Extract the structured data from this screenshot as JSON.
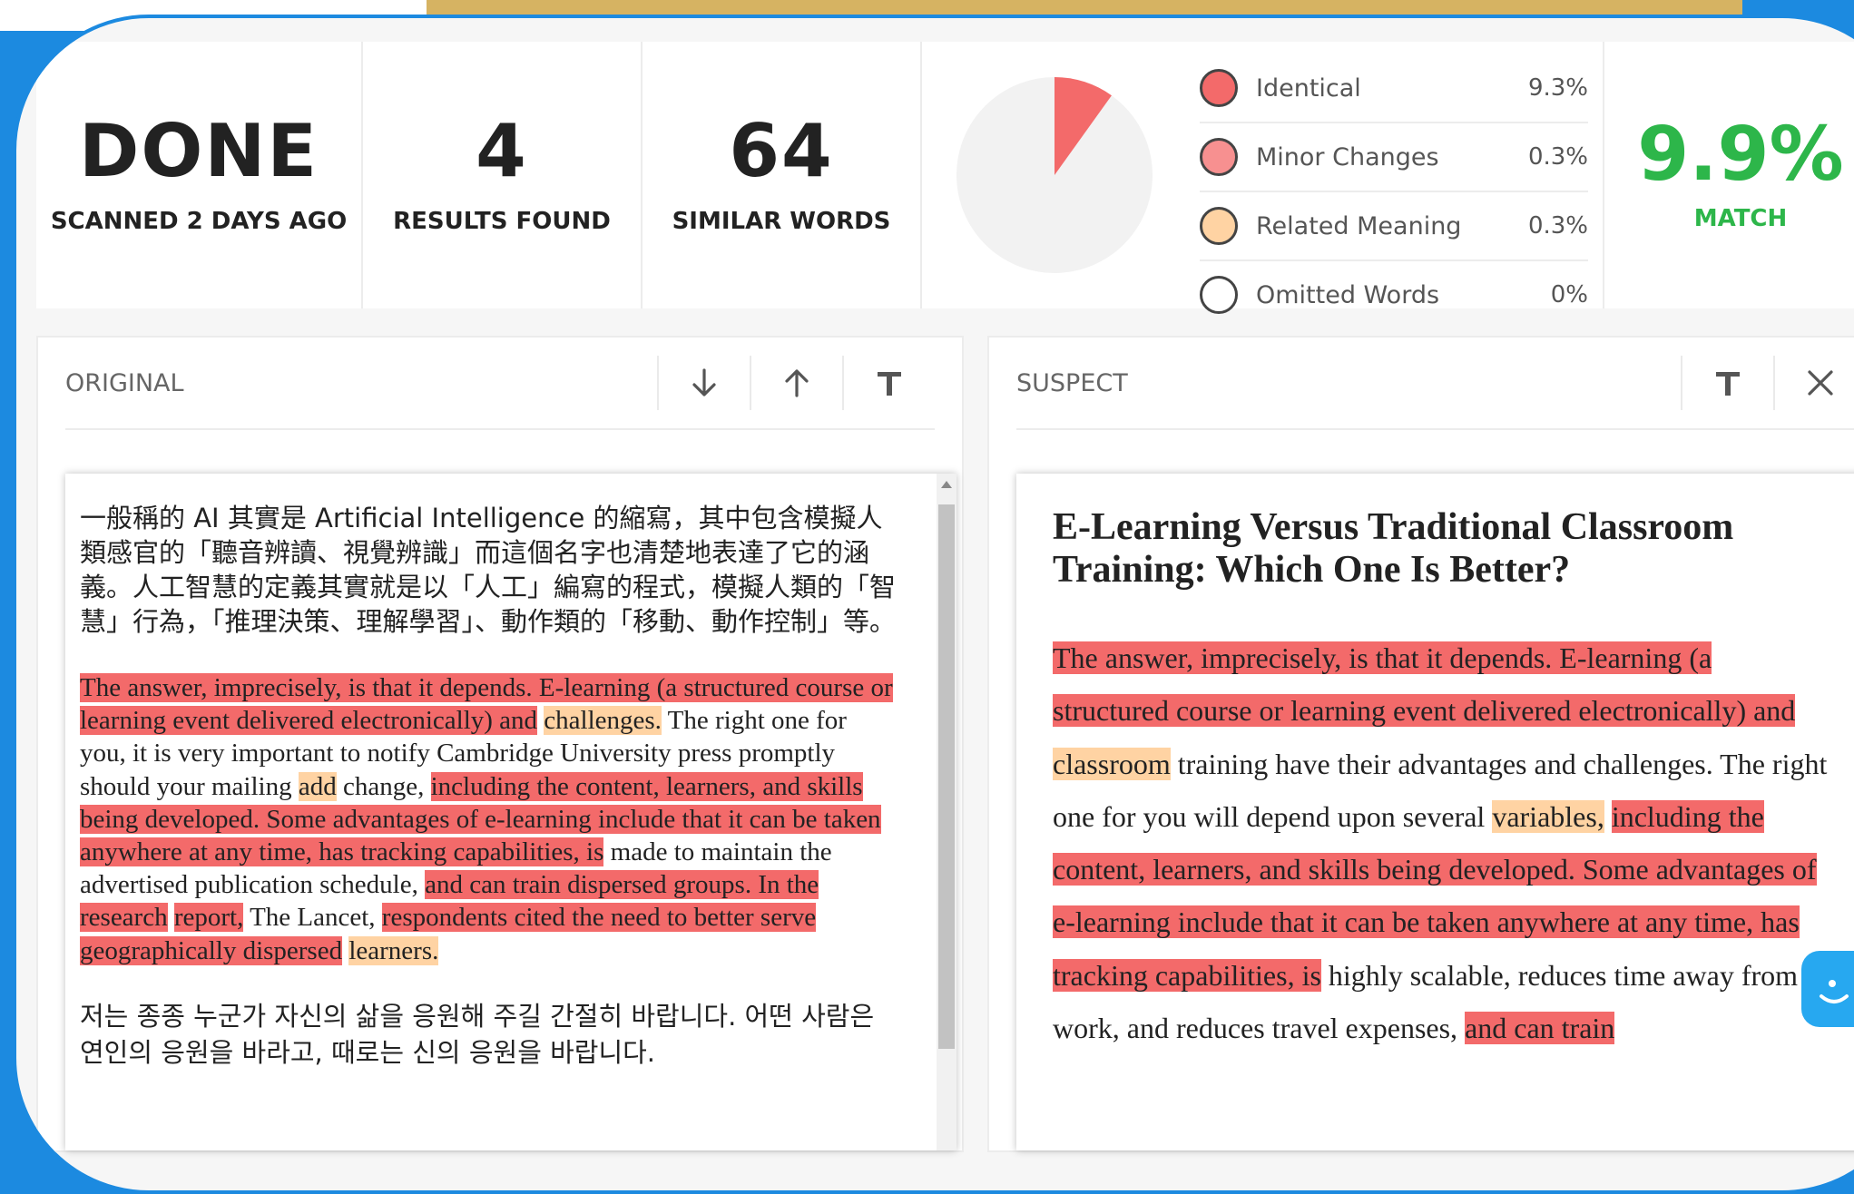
{
  "stats": {
    "status": {
      "value": "DONE",
      "label": "SCANNED 2 DAYS AGO"
    },
    "results": {
      "value": "4",
      "label": "RESULTS FOUND"
    },
    "similar": {
      "value": "64",
      "label": "SIMILAR WORDS"
    }
  },
  "legend": [
    {
      "label": "Identical",
      "value": "9.3%",
      "color": "#f36a6a"
    },
    {
      "label": "Minor Changes",
      "value": "0.3%",
      "color": "#f79090"
    },
    {
      "label": "Related Meaning",
      "value": "0.3%",
      "color": "#ffd3a3"
    },
    {
      "label": "Omitted Words",
      "value": "0%",
      "color": "#ffffff"
    }
  ],
  "pie": {
    "match_fraction": 0.099,
    "color": "#f36a6a",
    "bg": "#f2f2f2"
  },
  "match": {
    "value": "9.9%",
    "label": "MATCH"
  },
  "original": {
    "title": "ORIGINAL",
    "cn_paragraph": "一般稱的 AI 其實是 Artificial Intelligence 的縮寫，其中包含模擬人類感官的「聽音辨讀、視覺辨識」而這個名字也清楚地表達了它的涵義。人工智慧的定義其實就是以「人工」編寫的程式，模擬人類的「智慧」行為，「推理決策、理解學習」、動作類的「移動、動作控制」等。",
    "en_segments": [
      {
        "t": "The answer, imprecisely, is that it depends. E-learning (a structured course or learning event delivered electronically) and",
        "h": "r"
      },
      {
        "t": " ",
        "h": ""
      },
      {
        "t": "challenges.",
        "h": "o"
      },
      {
        "t": " The right one for you, it is very important to notify Cambridge University press promptly should your mailing ",
        "h": ""
      },
      {
        "t": "add",
        "h": "o"
      },
      {
        "t": " change, ",
        "h": ""
      },
      {
        "t": "including the content, learners, and skills being developed. Some advantages of e-learning include that it can be taken anywhere at any time, has tracking capabilities, is",
        "h": "r"
      },
      {
        "t": " made to maintain the advertised publication schedule, ",
        "h": ""
      },
      {
        "t": "and can train dispersed groups. In the research",
        "h": "r"
      },
      {
        "t": " ",
        "h": ""
      },
      {
        "t": "report,",
        "h": "r"
      },
      {
        "t": " The Lancet, ",
        "h": ""
      },
      {
        "t": "respondents cited the need to better serve geographically dispersed",
        "h": "r"
      },
      {
        "t": " ",
        "h": ""
      },
      {
        "t": "learners.",
        "h": "o"
      }
    ],
    "ko_paragraph": "저는 종종 누군가 자신의 삶을 응원해 주길 간절히 바랍니다. 어떤 사람은 연인의 응원을 바라고, 때로는 신의 응원을 바랍니다."
  },
  "suspect": {
    "title": "SUSPECT",
    "doc_title": "E-Learning Versus Traditional Classroom Training: Which One Is Better?",
    "segments": [
      {
        "t": "The answer, imprecisely, is that it depends. E-learning (a structured course or learning event delivered electronically) and",
        "h": "r"
      },
      {
        "t": " ",
        "h": ""
      },
      {
        "t": "classroom",
        "h": "o"
      },
      {
        "t": " training have their advantages and challenges. The right one for you will depend upon several ",
        "h": ""
      },
      {
        "t": "variables,",
        "h": "o"
      },
      {
        "t": " ",
        "h": ""
      },
      {
        "t": "including the content, learners, and skills being developed. Some advantages of e-learning include that it can be taken anywhere at any time, has tracking capabilities, is",
        "h": "r"
      },
      {
        "t": " highly scalable, reduces time away from work, and reduces travel expenses, ",
        "h": ""
      },
      {
        "t": "and can train",
        "h": "r"
      }
    ]
  }
}
